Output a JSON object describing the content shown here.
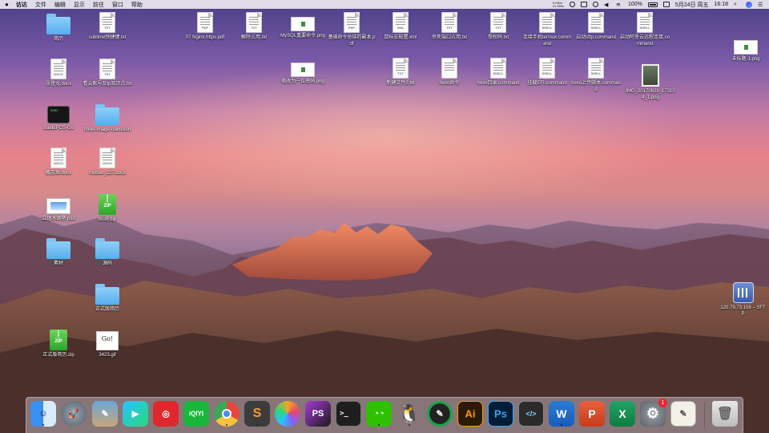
{
  "menubar": {
    "items": [
      "访达",
      "文件",
      "编辑",
      "显示",
      "前往",
      "窗口",
      "帮助"
    ],
    "net_up": "5 KB/s",
    "net_down": "21 KB/s",
    "battery": "100%",
    "date": "5月24日 周五",
    "time": "16:18"
  },
  "desktop": {
    "col1": [
      "简历",
      "张登龙.docx",
      "BaiduPCS-Go",
      "概志恒.docx",
      "立体水滴壁.psd",
      "素材",
      "正式版简历.zip"
    ],
    "col2": [
      "sublime快捷键.txt",
      "看云账号及tp知识点.txt",
      "three-image-transition",
      "moban_227.docx",
      "test6.zip",
      "源码",
      "正式版简历",
      "3423.gif"
    ],
    "row1": [
      "07 Nginx https.pdf",
      "解除占用.txt",
      "MySQL重要命令.png",
      "基础命令总结的副本.pdf",
      "鼠标宏配置.xml",
      "杀死端口占用.txt",
      "授权码.txt",
      "连接手机termux.command",
      "启动sftp.command",
      "启动阿里云远程连接.command"
    ],
    "row2": [
      "修改为一位密码.png",
      "新建文件2.txt",
      "hexo命令",
      "hexo目录.command",
      "挂载EFI.command",
      "hexo上传脚本.command",
      "IMG_20170829_173104_1.png"
    ],
    "right": [
      "未标题-1.png",
      "120.79.73.158 – SFTP"
    ],
    "tags": {
      "txt": "TXT",
      "pdf": "PDF",
      "docx": "DOCX",
      "xml": "XML",
      "shell": "SHELL",
      "zip": "ZIP",
      "exec": "exec"
    },
    "gif_text": "Go!"
  },
  "dock": {
    "apps": [
      {
        "name": "finder",
        "glyph": "☺"
      },
      {
        "name": "launchpad",
        "glyph": "🚀"
      },
      {
        "name": "preview",
        "glyph": "✎"
      },
      {
        "name": "video-player",
        "glyph": "▶"
      },
      {
        "name": "netease-music",
        "glyph": "◎"
      },
      {
        "name": "iqiyi",
        "glyph": "iQIYI"
      },
      {
        "name": "chrome",
        "glyph": ""
      },
      {
        "name": "sublime-text",
        "glyph": "S"
      },
      {
        "name": "app-colorful",
        "glyph": ""
      },
      {
        "name": "phpstorm",
        "glyph": "PS"
      },
      {
        "name": "terminal",
        "glyph": ">_"
      },
      {
        "name": "wechat",
        "glyph": "◔◔"
      },
      {
        "name": "qq",
        "glyph": "🐧"
      },
      {
        "name": "drawing-app",
        "glyph": "✎"
      },
      {
        "name": "illustrator",
        "glyph": "Ai"
      },
      {
        "name": "photoshop",
        "glyph": "Ps"
      },
      {
        "name": "code-editor",
        "glyph": "</>"
      },
      {
        "name": "word",
        "glyph": "W"
      },
      {
        "name": "powerpoint",
        "glyph": "P"
      },
      {
        "name": "excel",
        "glyph": "X"
      },
      {
        "name": "system-preferences",
        "glyph": "⚙",
        "badge": "1"
      },
      {
        "name": "textedit",
        "glyph": "✎"
      },
      {
        "name": "trash",
        "glyph": "🗑"
      }
    ]
  }
}
